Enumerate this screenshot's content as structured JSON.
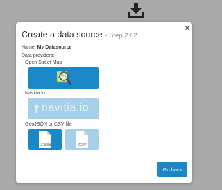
{
  "modal": {
    "title": "Create a data source",
    "step": "- Step 2 / 2",
    "close_label": "×",
    "name_label": "Name:",
    "name_value": "My Datasource",
    "providers_label": "Data providers:",
    "providers": [
      {
        "label": "Open Street Map",
        "icon": "osm-magnifier-icon",
        "color": "#1a88c6"
      },
      {
        "label": "Navitia.io",
        "logo_text": "navitia.io",
        "icon": "navitia-logo",
        "color": "#a6cfe8"
      },
      {
        "label": "GeoJSON or CSV file"
      }
    ],
    "files": [
      {
        "ext": ".JSON",
        "icon": "file-icon",
        "color": "#1a88c6"
      },
      {
        "ext": ".CSV",
        "icon": "file-icon",
        "color": "#a6cfe8"
      }
    ],
    "back_label": "Go back"
  }
}
